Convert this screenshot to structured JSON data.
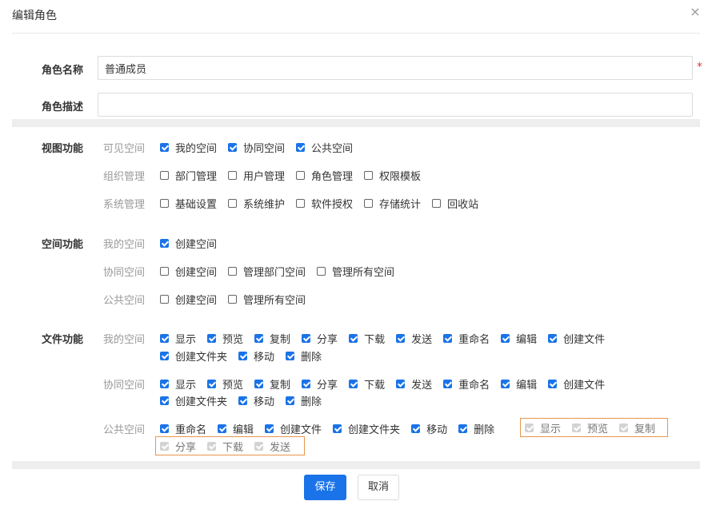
{
  "dialog": {
    "title": "编辑角色",
    "close_glyph": "×"
  },
  "form": {
    "name_label": "角色名称",
    "name_value": "普通成员",
    "required_mark": "*",
    "desc_label": "角色描述",
    "desc_value": ""
  },
  "view": {
    "section": "视图功能",
    "visible": {
      "label": "可见空间",
      "options": [
        {
          "text": "我的空间",
          "checked": true
        },
        {
          "text": "协同空间",
          "checked": true
        },
        {
          "text": "公共空间",
          "checked": true
        }
      ]
    },
    "org": {
      "label": "组织管理",
      "options": [
        {
          "text": "部门管理",
          "checked": false
        },
        {
          "text": "用户管理",
          "checked": false
        },
        {
          "text": "角色管理",
          "checked": false
        },
        {
          "text": "权限模板",
          "checked": false
        }
      ]
    },
    "sys": {
      "label": "系统管理",
      "options": [
        {
          "text": "基础设置",
          "checked": false
        },
        {
          "text": "系统维护",
          "checked": false
        },
        {
          "text": "软件授权",
          "checked": false
        },
        {
          "text": "存储统计",
          "checked": false
        },
        {
          "text": "回收站",
          "checked": false
        }
      ]
    }
  },
  "space": {
    "section": "空间功能",
    "mine": {
      "label": "我的空间",
      "options": [
        {
          "text": "创建空间",
          "checked": true
        }
      ]
    },
    "coop": {
      "label": "协同空间",
      "options": [
        {
          "text": "创建空间",
          "checked": false
        },
        {
          "text": "管理部门空间",
          "checked": false
        },
        {
          "text": "管理所有空间",
          "checked": false
        }
      ]
    },
    "public": {
      "label": "公共空间",
      "options": [
        {
          "text": "创建空间",
          "checked": false
        },
        {
          "text": "管理所有空间",
          "checked": false
        }
      ]
    }
  },
  "file": {
    "section": "文件功能",
    "mine": {
      "label": "我的空间",
      "line1": [
        {
          "text": "显示",
          "checked": true
        },
        {
          "text": "预览",
          "checked": true
        },
        {
          "text": "复制",
          "checked": true
        },
        {
          "text": "分享",
          "checked": true
        },
        {
          "text": "下载",
          "checked": true
        },
        {
          "text": "发送",
          "checked": true
        },
        {
          "text": "重命名",
          "checked": true
        },
        {
          "text": "编辑",
          "checked": true
        },
        {
          "text": "创建文件",
          "checked": true
        }
      ],
      "line2": [
        {
          "text": "创建文件夹",
          "checked": true
        },
        {
          "text": "移动",
          "checked": true
        },
        {
          "text": "删除",
          "checked": true
        }
      ]
    },
    "coop": {
      "label": "协同空间",
      "line1": [
        {
          "text": "显示",
          "checked": true
        },
        {
          "text": "预览",
          "checked": true
        },
        {
          "text": "复制",
          "checked": true
        },
        {
          "text": "分享",
          "checked": true
        },
        {
          "text": "下载",
          "checked": true
        },
        {
          "text": "发送",
          "checked": true
        },
        {
          "text": "重命名",
          "checked": true
        },
        {
          "text": "编辑",
          "checked": true
        },
        {
          "text": "创建文件",
          "checked": true
        }
      ],
      "line2": [
        {
          "text": "创建文件夹",
          "checked": true
        },
        {
          "text": "移动",
          "checked": true
        },
        {
          "text": "删除",
          "checked": true
        }
      ]
    },
    "public": {
      "label": "公共空间",
      "line1": [
        {
          "text": "重命名",
          "checked": true
        },
        {
          "text": "编辑",
          "checked": true
        },
        {
          "text": "创建文件",
          "checked": true
        },
        {
          "text": "创建文件夹",
          "checked": true
        },
        {
          "text": "移动",
          "checked": true
        },
        {
          "text": "删除",
          "checked": true
        }
      ],
      "disabled1": [
        {
          "text": "显示",
          "checked": true,
          "disabled": true
        },
        {
          "text": "预览",
          "checked": true,
          "disabled": true
        },
        {
          "text": "复制",
          "checked": true,
          "disabled": true
        }
      ],
      "disabled2": [
        {
          "text": "分享",
          "checked": true,
          "disabled": true
        },
        {
          "text": "下载",
          "checked": true,
          "disabled": true
        },
        {
          "text": "发送",
          "checked": true,
          "disabled": true
        }
      ]
    }
  },
  "footer": {
    "save": "保存",
    "cancel": "取消"
  },
  "colors": {
    "primary": "#1a73e8",
    "highlight_border": "#e8964a",
    "required": "#e23c3c"
  }
}
